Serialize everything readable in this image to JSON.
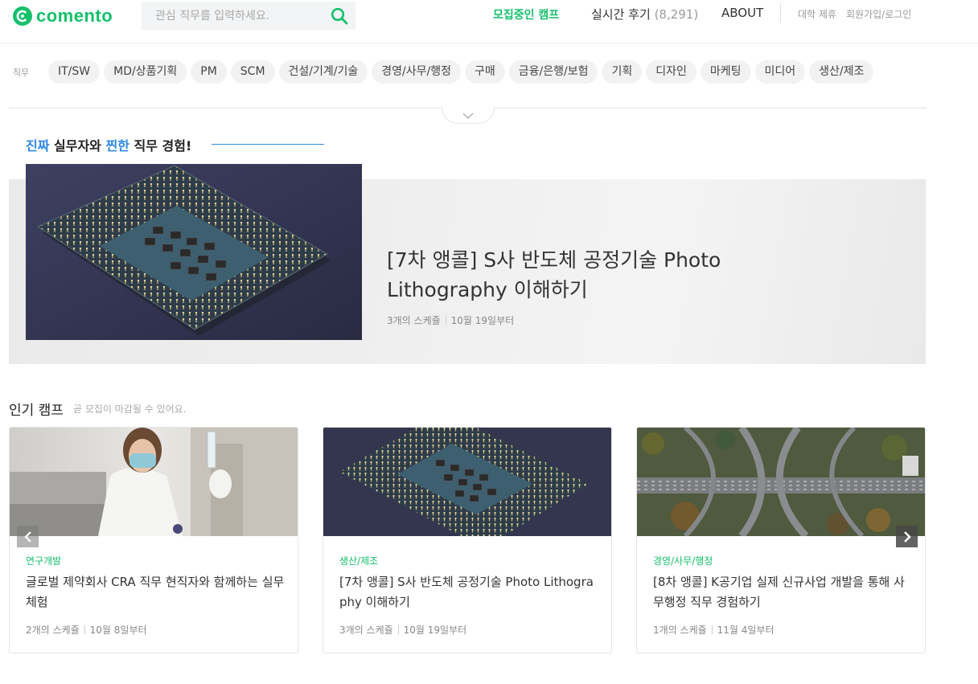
{
  "brand": {
    "name": "comento",
    "accent": "#15c06b",
    "highlight": "#2f87e5"
  },
  "search": {
    "placeholder": "관심 직무를 입력하세요."
  },
  "nav": {
    "camps": "모집중인 캠프",
    "reviews": "실시간 후기",
    "reviews_count": "(8,291)",
    "about": "ABOUT",
    "partner": "대학 제휴",
    "login": "회원가입/로그인"
  },
  "categories": {
    "label": "직무",
    "items": [
      "IT/SW",
      "MD/상품기획",
      "PM",
      "SCM",
      "건설/기계/기술",
      "경영/사무/행정",
      "구매",
      "금융/은행/보험",
      "기획",
      "디자인",
      "마케팅",
      "미디어",
      "생산/제조"
    ]
  },
  "section": {
    "hl1": "진짜",
    "t1": " 실무자와 ",
    "hl2": "찐한",
    "t2": " 직무 경험!"
  },
  "hero": {
    "title": "[7차 앵콜] S사 반도체 공정기술 Photo Lithography 이해하기",
    "schedules": "3개의 스케쥴",
    "date": "10월 19일부터"
  },
  "popular": {
    "title": "인기 캠프",
    "subtitle": "곧 모집이 마감될 수 있어요.",
    "cards": [
      {
        "category": "연구개발",
        "title": "글로벌 제약회사 CRA 직무 현직자와 함께하는 실무 체험",
        "schedules": "2개의 스케쥴",
        "date": "10월 8일부터"
      },
      {
        "category": "생산/제조",
        "title": "[7차 앵콜] S사 반도체 공정기술 Photo Lithography 이해하기",
        "schedules": "3개의 스케쥴",
        "date": "10월 19일부터"
      },
      {
        "category": "경영/사무/행정",
        "title": "[8차 앵콜] K공기업 실제 신규사업 개발을 통해 사무행정 직무 경험하기",
        "schedules": "1개의 스케쥴",
        "date": "11월 4일부터"
      }
    ]
  }
}
